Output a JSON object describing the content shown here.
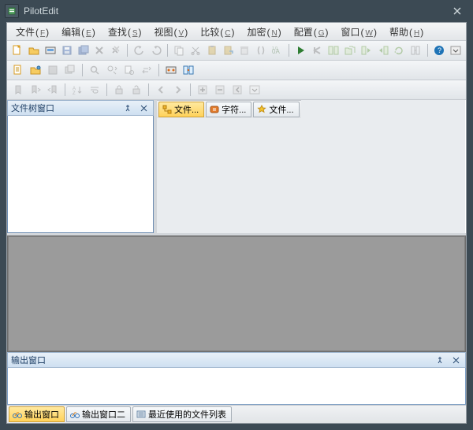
{
  "title": "PilotEdit",
  "menus": [
    {
      "label": "文件",
      "accel": "F"
    },
    {
      "label": "编辑",
      "accel": "E"
    },
    {
      "label": "查找",
      "accel": "S"
    },
    {
      "label": "视图",
      "accel": "V"
    },
    {
      "label": "比较",
      "accel": "C"
    },
    {
      "label": "加密",
      "accel": "N"
    },
    {
      "label": "配置",
      "accel": "G"
    },
    {
      "label": "窗口",
      "accel": "W"
    },
    {
      "label": "帮助",
      "accel": "H"
    }
  ],
  "panels": {
    "fileTree": {
      "title": "文件树窗口"
    },
    "output": {
      "title": "输出窗口"
    }
  },
  "leftTabs": [
    {
      "label": "文件...",
      "active": true
    },
    {
      "label": "字符...",
      "active": false
    },
    {
      "label": "文件...",
      "active": false
    }
  ],
  "bottomTabs": [
    {
      "label": "输出窗口",
      "active": true
    },
    {
      "label": "输出窗口二",
      "active": false
    },
    {
      "label": "最近使用的文件列表",
      "active": false
    }
  ]
}
